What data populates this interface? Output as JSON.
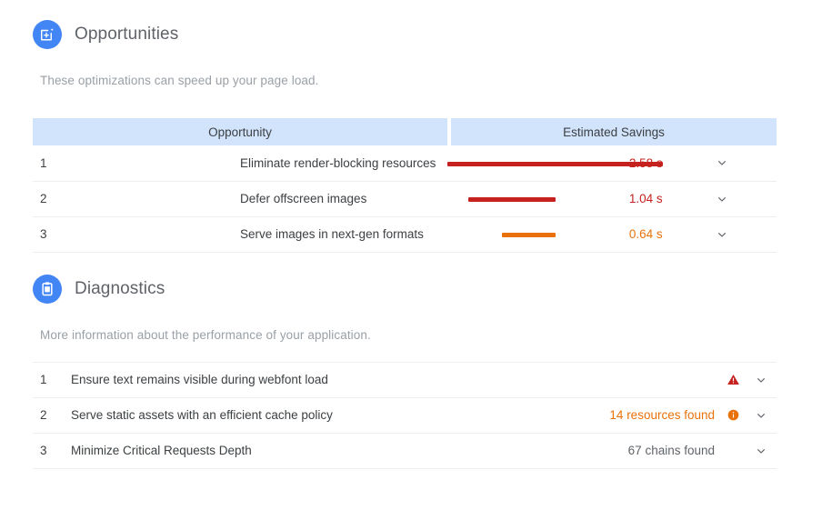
{
  "opportunities": {
    "title": "Opportunities",
    "icon": "opportunity-page-add-icon",
    "subtitle": "These optimizations can speed up your page load.",
    "columns": {
      "opportunity": "Opportunity",
      "savings": "Estimated Savings"
    },
    "rows": [
      {
        "index": "1",
        "title": "Eliminate render-blocking resources",
        "value": "2.58 s",
        "seconds": 2.58,
        "color": "#c5221f",
        "chevron": "chevron-down-icon"
      },
      {
        "index": "2",
        "title": "Defer offscreen images",
        "value": "1.04 s",
        "seconds": 1.04,
        "color": "#c5221f",
        "chevron": "chevron-down-icon"
      },
      {
        "index": "3",
        "title": "Serve images in next-gen formats",
        "value": "0.64 s",
        "seconds": 0.64,
        "color": "#e8710a",
        "chevron": "chevron-down-icon"
      }
    ]
  },
  "diagnostics": {
    "title": "Diagnostics",
    "icon": "clipboard-icon",
    "subtitle": "More information about the performance of your application.",
    "rows": [
      {
        "index": "1",
        "title": "Ensure text remains visible during webfont load",
        "value": "",
        "badge": "warning-triangle-icon",
        "badge_color": "#c5221f",
        "value_color": "#5f6368",
        "chevron": "chevron-down-icon"
      },
      {
        "index": "2",
        "title": "Serve static assets with an efficient cache policy",
        "value": "14 resources found",
        "badge": "info-circle-icon",
        "badge_color": "#e8710a",
        "value_color": "#e8710a",
        "chevron": "chevron-down-icon"
      },
      {
        "index": "3",
        "title": "Minimize Critical Requests Depth",
        "value": "67 chains found",
        "badge": "",
        "badge_color": "",
        "value_color": "#5f6368",
        "chevron": "chevron-down-icon"
      }
    ]
  },
  "theme": {
    "accent_blue": "#4285f4",
    "header_bg": "#d2e3fc",
    "divider": "#eceff1",
    "text": "#3c4043",
    "muted": "#9aa0a6",
    "red": "#c5221f",
    "orange": "#e8710a"
  },
  "chart_data": {
    "type": "bar",
    "title": "Estimated Savings",
    "categories": [
      "Eliminate render-blocking resources",
      "Defer offscreen images",
      "Serve images in next-gen formats"
    ],
    "values": [
      2.58,
      1.04,
      0.64
    ],
    "unit": "s",
    "xlabel": "",
    "ylabel": "Estimated Savings",
    "xlim": [
      0,
      2.58
    ],
    "orientation": "horizontal-right-aligned",
    "grid": false,
    "legend": "none",
    "bar_colors": [
      "#c5221f",
      "#c5221f",
      "#e8710a"
    ]
  }
}
